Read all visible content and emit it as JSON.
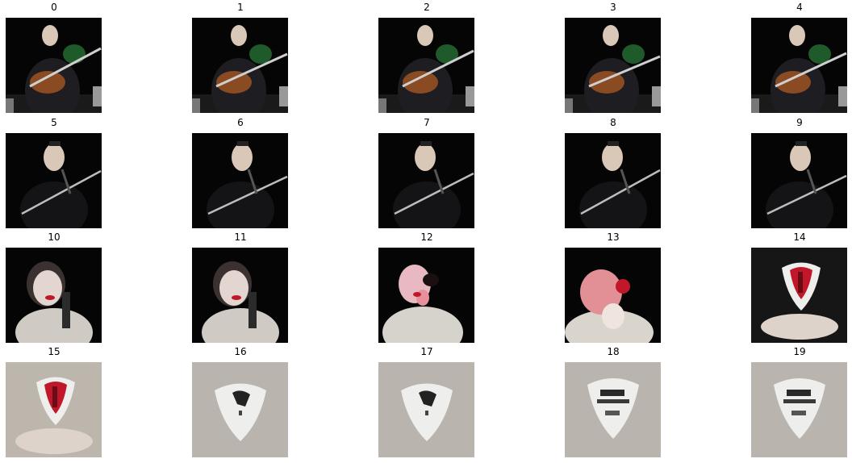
{
  "frames": [
    {
      "label": "0",
      "scene": "guitarist"
    },
    {
      "label": "1",
      "scene": "guitarist"
    },
    {
      "label": "2",
      "scene": "guitarist"
    },
    {
      "label": "3",
      "scene": "guitarist"
    },
    {
      "label": "4",
      "scene": "guitarist"
    },
    {
      "label": "5",
      "scene": "dark-person"
    },
    {
      "label": "6",
      "scene": "dark-person"
    },
    {
      "label": "7",
      "scene": "dark-person"
    },
    {
      "label": "8",
      "scene": "dark-person"
    },
    {
      "label": "9",
      "scene": "dark-person"
    },
    {
      "label": "10",
      "scene": "singer"
    },
    {
      "label": "11",
      "scene": "singer"
    },
    {
      "label": "12",
      "scene": "singer-red"
    },
    {
      "label": "13",
      "scene": "red-face"
    },
    {
      "label": "14",
      "scene": "red-pick-hand"
    },
    {
      "label": "15",
      "scene": "red-pick-hand"
    },
    {
      "label": "16",
      "scene": "pick"
    },
    {
      "label": "17",
      "scene": "pick"
    },
    {
      "label": "18",
      "scene": "pick-text"
    },
    {
      "label": "19",
      "scene": "pick-text"
    }
  ],
  "colors": {
    "dark_bg": "#050505",
    "skin": "#d9c8b8",
    "guitar": "#8a4a22",
    "red": "#c0182a",
    "grey_bg": "#b9b4ad",
    "pick": "#eeeeec"
  }
}
